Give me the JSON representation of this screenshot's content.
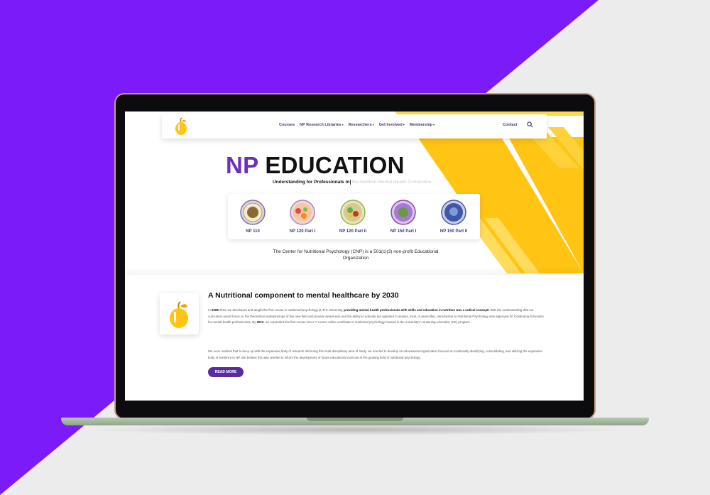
{
  "colors": {
    "brand_purple": "#6f2dbd",
    "background_purple": "#7b1cf8",
    "accent_yellow": "#ffc414",
    "nav_text": "#3b3b7a"
  },
  "nav": {
    "logo_icon": "apple-logo-icon",
    "items": [
      {
        "label": "Courses",
        "has_dropdown": false
      },
      {
        "label": "NP Research Libraries",
        "has_dropdown": true
      },
      {
        "label": "Researchers",
        "has_dropdown": true
      },
      {
        "label": "Get Involved",
        "has_dropdown": true
      },
      {
        "label": "Membership",
        "has_dropdown": true
      }
    ],
    "contact": "Contact",
    "search_icon": "search-icon"
  },
  "hero": {
    "title_accent": "NP",
    "title_rest": " EDUCATION",
    "subtitle_bold": "Understanding for Professionals in",
    "subtitle_faded": "the Nutrition-Mental Health Connection",
    "note": "The Center for Nutritional Psychology (CNP) is a 501(c)(3) non-profit Educational Organization"
  },
  "courses": [
    {
      "label": "NP 110"
    },
    {
      "label": "NP 120 Part I"
    },
    {
      "label": "NP 120 Part II"
    },
    {
      "label": "NP 150 Part I"
    },
    {
      "label": "NP 150 Part II"
    }
  ],
  "about": {
    "title": "A Nutritional component to mental healthcare by 2030",
    "p1_a": "In ",
    "p1_year1": "2008",
    "p1_b": " when we developed and taught the first course in nutritional psychology at JFK University, ",
    "p1_bold": "providing mental health professionals with skills and education in nutrition was a radical concept!",
    "p1_c": " With the understanding that our curriculum would focus on the theoretical underpinnings of this new field and provide awareness and the ability to educate (as opposed to assess, treat, or prescribe), Introduction to Nutritional Psychology was approved for Continuing Education for mental health professionals. By ",
    "p1_year2": "2012",
    "p1_d": ", we expanded this first course into a 7-course online certificate in nutritional psychology housed in the university's continuing education (CE) program.",
    "p2": "We soon realized that to keep up with the expansive body of research informing this multi-disciplinary area of study, we needed to develop an educational organization focused on continually identifying, consolidating, and utilizing the expansive body of evidence in NP. We believe this was needed to inform the development of future educational curricula in the growing field of nutritional psychology.",
    "read_more": "READ MORE"
  }
}
